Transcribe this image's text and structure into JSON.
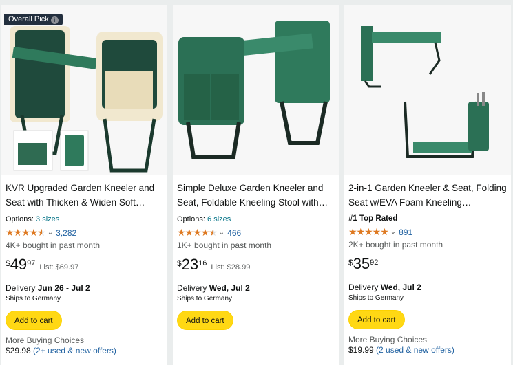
{
  "colors": {
    "accent": "#ffd814",
    "link": "#2162a1",
    "star": "#de7921",
    "badge_bg": "#232f3e"
  },
  "products": [
    {
      "badge": "Overall Pick",
      "badge_icon": "info-icon",
      "title": "KVR Upgraded Garden Kneeler and Seat with Thicken & Widen Soft…",
      "options_label": "Options:",
      "options_value": "3 sizes",
      "rating": 4.5,
      "rating_count": "3,282",
      "bought": "4K+ bought in past month",
      "price_symbol": "$",
      "price_whole": "49",
      "price_fraction": "97",
      "list_label": "List:",
      "list_price": "$69.97",
      "delivery_label": "Delivery",
      "delivery_date": "Jun 26 - Jul 2",
      "ships_to": "Ships to Germany",
      "cart_label": "Add to cart",
      "more_label": "More Buying Choices",
      "more_price": "$29.98",
      "more_offers": "(2+ used & new offers)"
    },
    {
      "title": "Simple Deluxe Garden Kneeler and Seat, Foldable Kneeling Stool with…",
      "options_label": "Options:",
      "options_value": "6 sizes",
      "rating": 4.5,
      "rating_count": "466",
      "bought": "1K+ bought in past month",
      "price_symbol": "$",
      "price_whole": "23",
      "price_fraction": "16",
      "list_label": "List:",
      "list_price": "$28.99",
      "delivery_label": "Delivery",
      "delivery_date": "Wed, Jul 2",
      "ships_to": "Ships to Germany",
      "cart_label": "Add to cart"
    },
    {
      "title": "2-in-1 Garden Kneeler & Seat, Folding Seat w/EVA Foam Kneeling…",
      "top_rated": "#1 Top Rated",
      "rating": 5,
      "rating_count": "891",
      "bought": "2K+ bought in past month",
      "price_symbol": "$",
      "price_whole": "35",
      "price_fraction": "92",
      "delivery_label": "Delivery",
      "delivery_date": "Wed, Jul 2",
      "ships_to": "Ships to Germany",
      "cart_label": "Add to cart",
      "more_label": "More Buying Choices",
      "more_price": "$19.99",
      "more_offers": "(2 used & new offers)"
    }
  ]
}
